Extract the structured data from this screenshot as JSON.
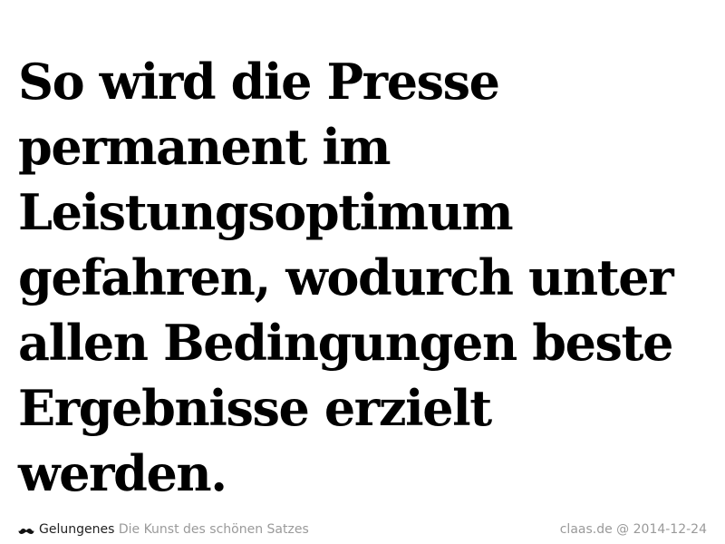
{
  "quote": {
    "lines": [
      "So wird die Presse",
      "permanent im",
      "Leistungsoptimum",
      "gefahren, wodurch unter",
      "allen Bedingungen beste",
      "Ergebnisse erzielt",
      "werden."
    ]
  },
  "footer": {
    "icon": "mustache-icon",
    "brand": "Gelungenes",
    "tagline": "Die Kunst des schönen Satzes",
    "meta": "claas.de @ 2014-12-24"
  }
}
